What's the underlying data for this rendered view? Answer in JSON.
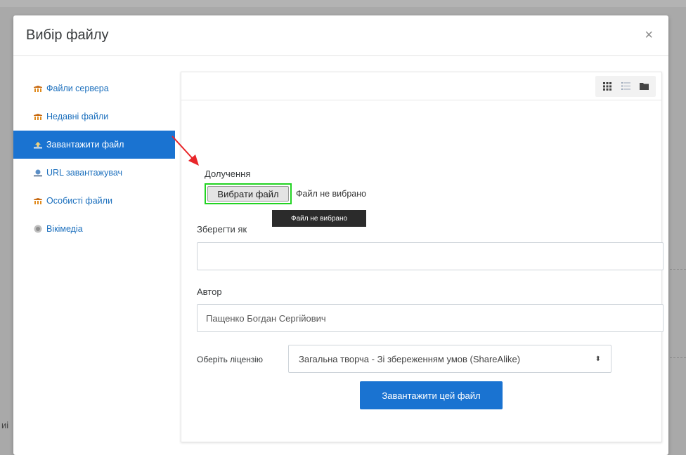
{
  "modal": {
    "title": "Вибір файлу",
    "close_label": "×"
  },
  "sidebar": {
    "items": [
      {
        "label": "Файли сервера",
        "icon": "repository-icon",
        "active": false
      },
      {
        "label": "Недавні файли",
        "icon": "repository-icon",
        "active": false
      },
      {
        "label": "Завантажити файл",
        "icon": "upload-icon",
        "active": true
      },
      {
        "label": "URL завантажувач",
        "icon": "url-downloader-icon",
        "active": false
      },
      {
        "label": "Особисті файли",
        "icon": "repository-icon",
        "active": false
      },
      {
        "label": "Вікімедіа",
        "icon": "wikimedia-icon",
        "active": false
      }
    ]
  },
  "toolbar": {
    "views": [
      "grid-view-icon",
      "list-view-icon",
      "folder-view-icon"
    ]
  },
  "form": {
    "attachment_label": "Долучення",
    "choose_file_label": "Вибрати файл",
    "file_status": "Файл не вибрано",
    "tooltip": "Файл не вибрано",
    "save_as_label": "Зберегти як",
    "save_as_value": "",
    "author_label": "Автор",
    "author_value": "Пащенко Богдан Сергійович",
    "license_label": "Оберіть ліцензію",
    "license_value": "Загальна творча - Зі збереженням умов (ShareAlike)",
    "upload_button": "Завантажити цей файл"
  },
  "annotation": {
    "arrow_color": "#e8262a",
    "highlight_color": "#22d322"
  },
  "backdrop": {
    "fragment_text": "иі"
  }
}
